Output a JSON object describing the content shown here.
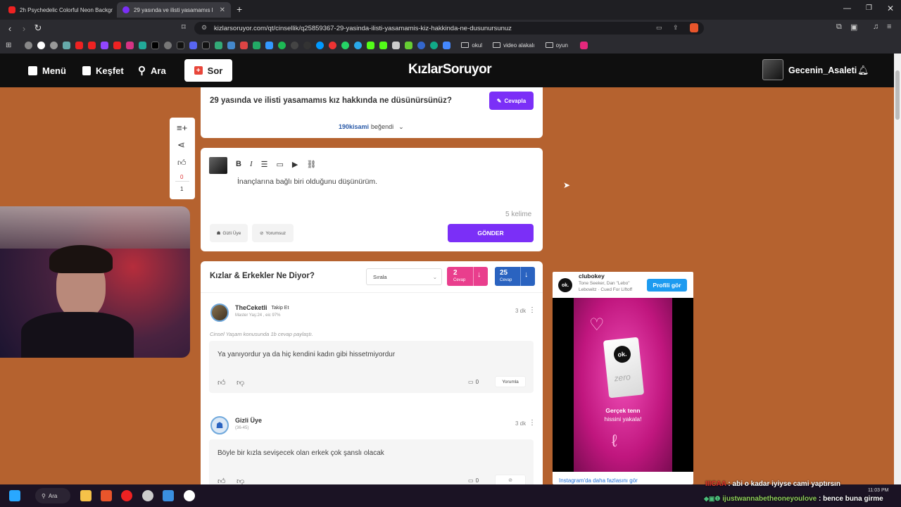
{
  "browser": {
    "tabs": [
      {
        "title": "2h Psychedelic Colorful Neon Backgr"
      },
      {
        "title": "29 yasında ve ilisti yasamamıs kız"
      }
    ],
    "url": "kizlarsoruyor.com/qt/cinsellik/q25859367-29-yasinda-ilisti-yasamamis-kiz-hakkinda-ne-dusunursunuz",
    "bookmark_folders": [
      "okul",
      "video alakalı",
      "oyun"
    ]
  },
  "header": {
    "menu": "Menü",
    "explore": "Keşfet",
    "search": "Ara",
    "ask": "Sor",
    "logo": "KızlarSoruyor",
    "username": "Gecenin_Asaleti"
  },
  "question": {
    "title": "29 yasında ve ilisti yasamamıs kız hakkında ne düsünürsünüz?",
    "answer_button": "Cevapla",
    "likes_user": "190kisami",
    "likes_suffix": "beğendi"
  },
  "side_actions": {
    "likes": "0",
    "count": "1"
  },
  "editor": {
    "text": "İnançlarına bağlı biri olduğunu düşünürüm.",
    "word_count": "5 kelime",
    "anon_label": "Gizli Üye",
    "no_comment_label": "Yorumsuz",
    "submit": "GÖNDER"
  },
  "answers_section": {
    "title": "Kızlar & Erkekler Ne Diyor?",
    "sort_placeholder": "Sırala",
    "girls_count": "2",
    "girls_label": "Cevap",
    "boys_count": "25",
    "boys_label": "Cevap"
  },
  "answers": [
    {
      "name": "TheCeketli",
      "follow": "Takip Et",
      "meta": "Master Yaş:24 , eic 97%",
      "time": "3 dk",
      "context": "Cinsel Yaşam konusunda 1b cevap paylaştı.",
      "body": "Ya yanıyordur ya da hiç kendini kadın gibi hissetmiyordur",
      "comments": "0",
      "comment_btn": "Yorumla"
    },
    {
      "name": "Gizli Üye",
      "meta": "(36-45)",
      "time": "3 dk",
      "body": "Böyle bir kızla sevişecek olan erkek çok şanslı olacak",
      "comments": "0"
    }
  ],
  "ad": {
    "account": "clubokey",
    "subtitle": "Tone Seeker, Dan \"Lebo\" Lebowitz · Cued For Liftoff",
    "profile_button": "Profili gör",
    "brand": "ok.",
    "product": "zero",
    "slogan_line1": "Gerçek tenn",
    "slogan_line2": "hissini yakala!",
    "footer_link": "Instagram'da daha fazlasını gör"
  },
  "chat": [
    {
      "user": "IIICAA",
      "message": "abi o kadar iyiyse cami yaptırsın"
    },
    {
      "user": "ijustwannabetheoneyoulove",
      "message": "bence buna girme"
    }
  ],
  "taskbar": {
    "search": "Ara",
    "time": "11:03 PM"
  }
}
